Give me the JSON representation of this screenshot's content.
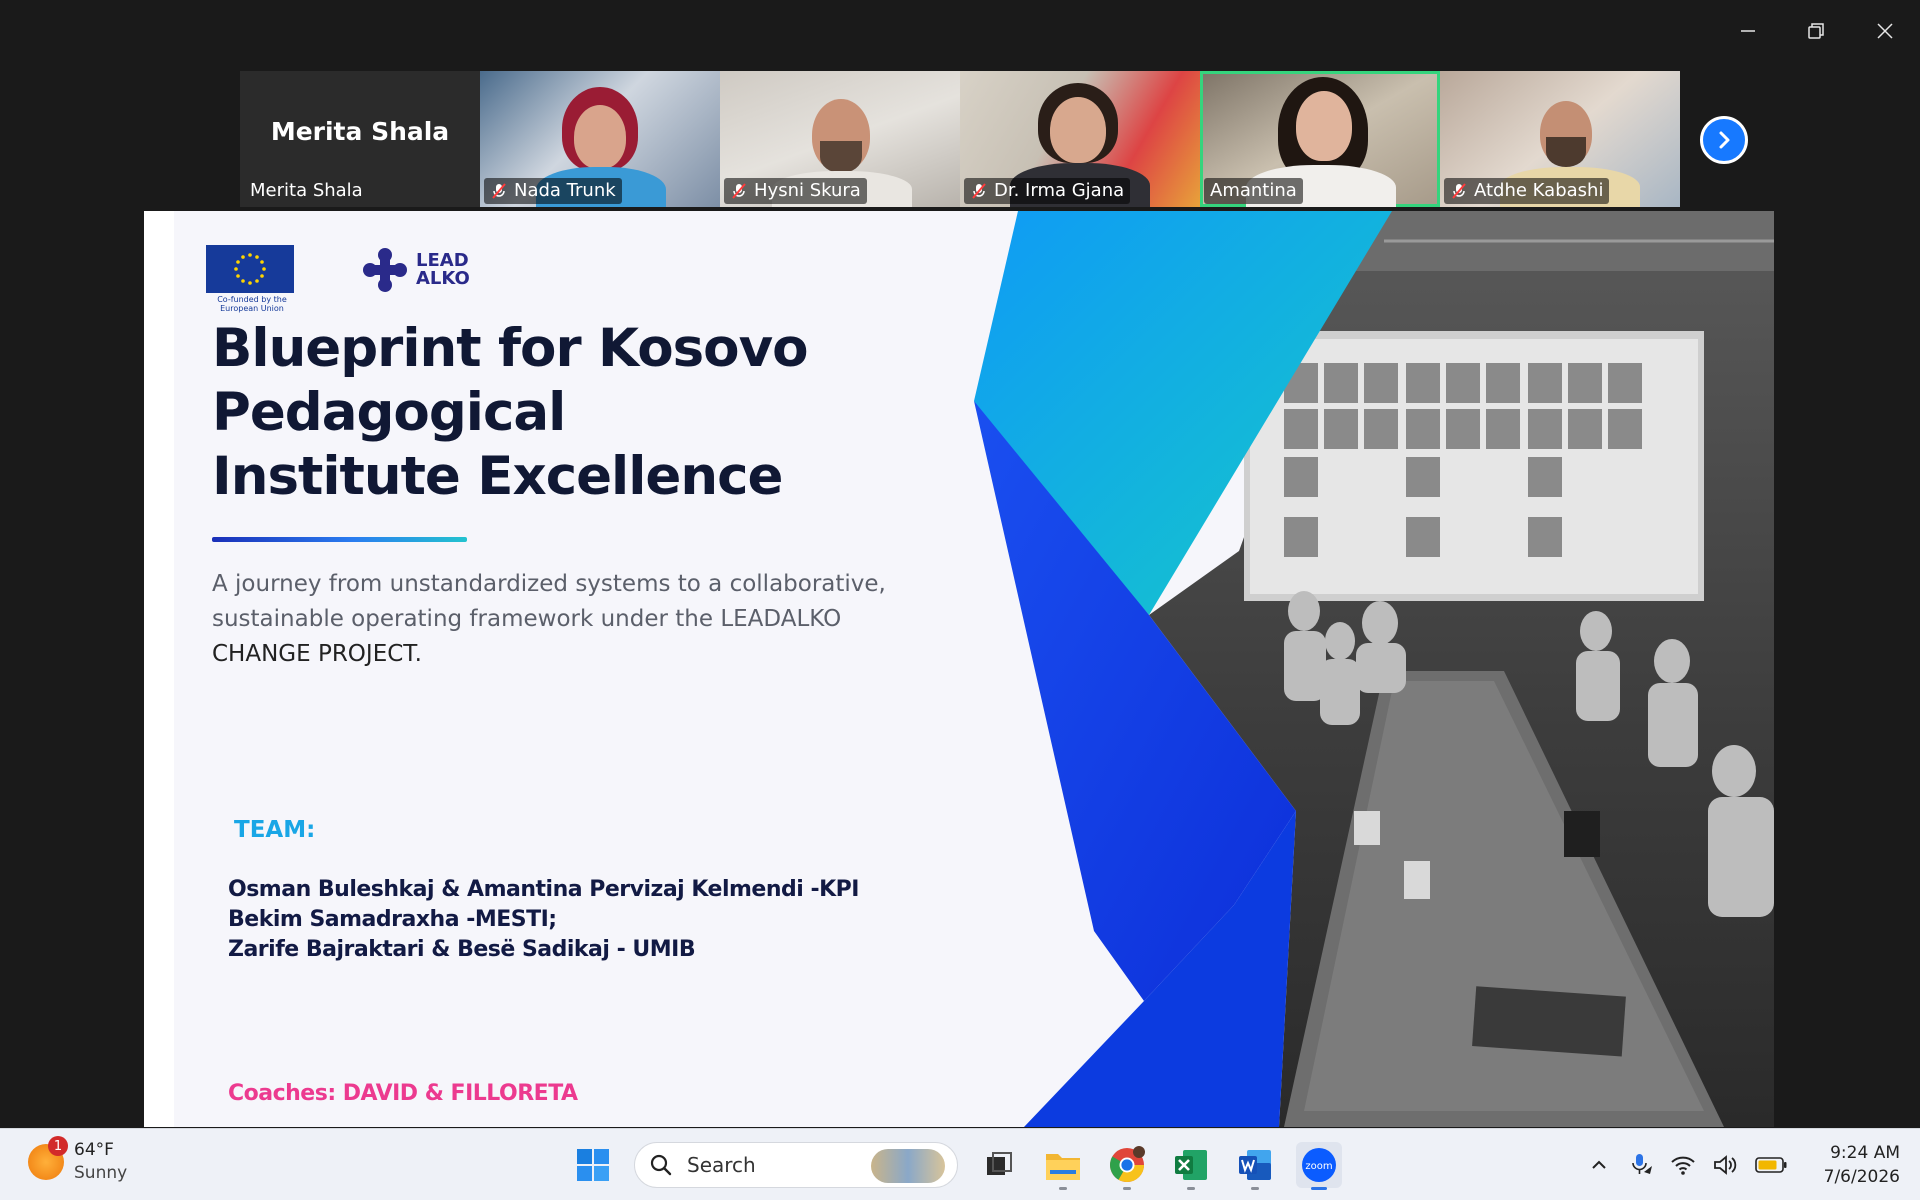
{
  "participants": [
    {
      "name": "Merita Shala",
      "display_name": "Merita Shala",
      "muted": false,
      "video": false
    },
    {
      "name": "Nada Trunk",
      "muted": true,
      "video": true
    },
    {
      "name": "Hysni Skura",
      "muted": true,
      "video": true
    },
    {
      "name": "Dr. Irma Gjana",
      "muted": true,
      "video": true
    },
    {
      "name": "Amantina",
      "muted": false,
      "video": true,
      "active_speaker": true
    },
    {
      "name": "Atdhe Kabashi",
      "muted": true,
      "video": true
    }
  ],
  "slide": {
    "eu_caption": "Co-funded by the European Union",
    "logo_top": "LEAD",
    "logo_bottom": "ALKO",
    "title_line1": "Blueprint for Kosovo",
    "title_line2": "Pedagogical",
    "title_line3": "Institute Excellence",
    "subtitle_line1": "A journey from unstandardized systems to a collaborative,",
    "subtitle_line2": "sustainable operating framework under the LEADALKO",
    "subtitle_line3": "CHANGE PROJECT.",
    "team_label": "TEAM:",
    "team_line1": "Osman Buleshkaj & Amantina Pervizaj Kelmendi -KPI",
    "team_line2": "Bekim Samadraxha -MESTI;",
    "team_line3": "Zarife Bajraktari & Besë Sadikaj - UMIB",
    "coaches": "Coaches: DAVID & FILLORETA"
  },
  "taskbar": {
    "weather": {
      "temp": "64°F",
      "condition": "Sunny",
      "badge": "1"
    },
    "search_placeholder": "Search",
    "zoom_label": "zoom",
    "clock": {
      "time": "9:24 AM",
      "date": "7/6/2026"
    }
  },
  "colors": {
    "accent_blue": "#1779ff",
    "active_speaker": "#35d47d",
    "title_text": "#101834",
    "team_label": "#19a6e6",
    "coaches": "#ec3a8f"
  }
}
